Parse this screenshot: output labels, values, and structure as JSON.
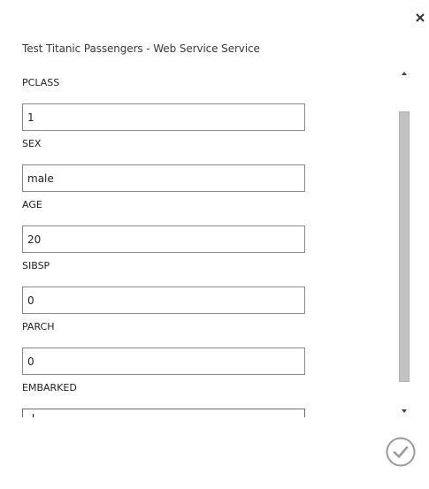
{
  "dialog": {
    "title": "Test Titanic Passengers - Web Service Service",
    "close_icon": "close-icon",
    "confirm_icon": "checkmark-circle-icon"
  },
  "fields": [
    {
      "label": "PCLASS",
      "value": "1"
    },
    {
      "label": "SEX",
      "value": "male"
    },
    {
      "label": "AGE",
      "value": "20"
    },
    {
      "label": "SIBSP",
      "value": "0"
    },
    {
      "label": "PARCH",
      "value": "0"
    },
    {
      "label": "EMBARKED",
      "value": "C"
    }
  ],
  "colors": {
    "scroll_thumb": "#c2c2c2",
    "input_border": "#8a8a8a",
    "confirm_icon": "#9a9a9a"
  }
}
